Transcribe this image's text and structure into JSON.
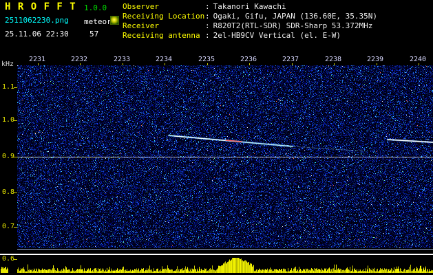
{
  "header": {
    "app_title": "H R O F F T",
    "version": "1.0.0",
    "filename": "2511062230.png",
    "mode_label": "meteor",
    "timestamp": "25.11.06 22:30",
    "echo_count": "57",
    "colon": ":",
    "info_rows": [
      {
        "label": "Observer",
        "value": "Takanori Kawachi"
      },
      {
        "label": "Receiving Location",
        "value": "Ogaki, Gifu, JAPAN (136.60E, 35.35N)"
      },
      {
        "label": "Receiver",
        "value": "R820T2(RTL-SDR) SDR-Sharp 53.372MHz"
      },
      {
        "label": "Receiving antenna",
        "value": "2el-HB9CV Vertical (el. E-W)"
      }
    ]
  },
  "spectrogram": {
    "unit_label": "kHz",
    "freq_ticks": [
      "1.1",
      "1.0",
      "0.9",
      "0.8",
      "0.7",
      "0.6"
    ],
    "time_ticks": [
      "2231",
      "2232",
      "2233",
      "2234",
      "2235",
      "2236",
      "2237",
      "2238",
      "2239",
      "2240"
    ],
    "carrier_freq_khz": "0.9",
    "colors": {
      "noise_blue": "#0000c8",
      "echo_cyan": "#aaffff",
      "echo_red": "#ff5f5f",
      "carrier_line": "#b8c4e8",
      "level_bars": "#e8e800",
      "axis_labels": "#e8e800"
    }
  }
}
